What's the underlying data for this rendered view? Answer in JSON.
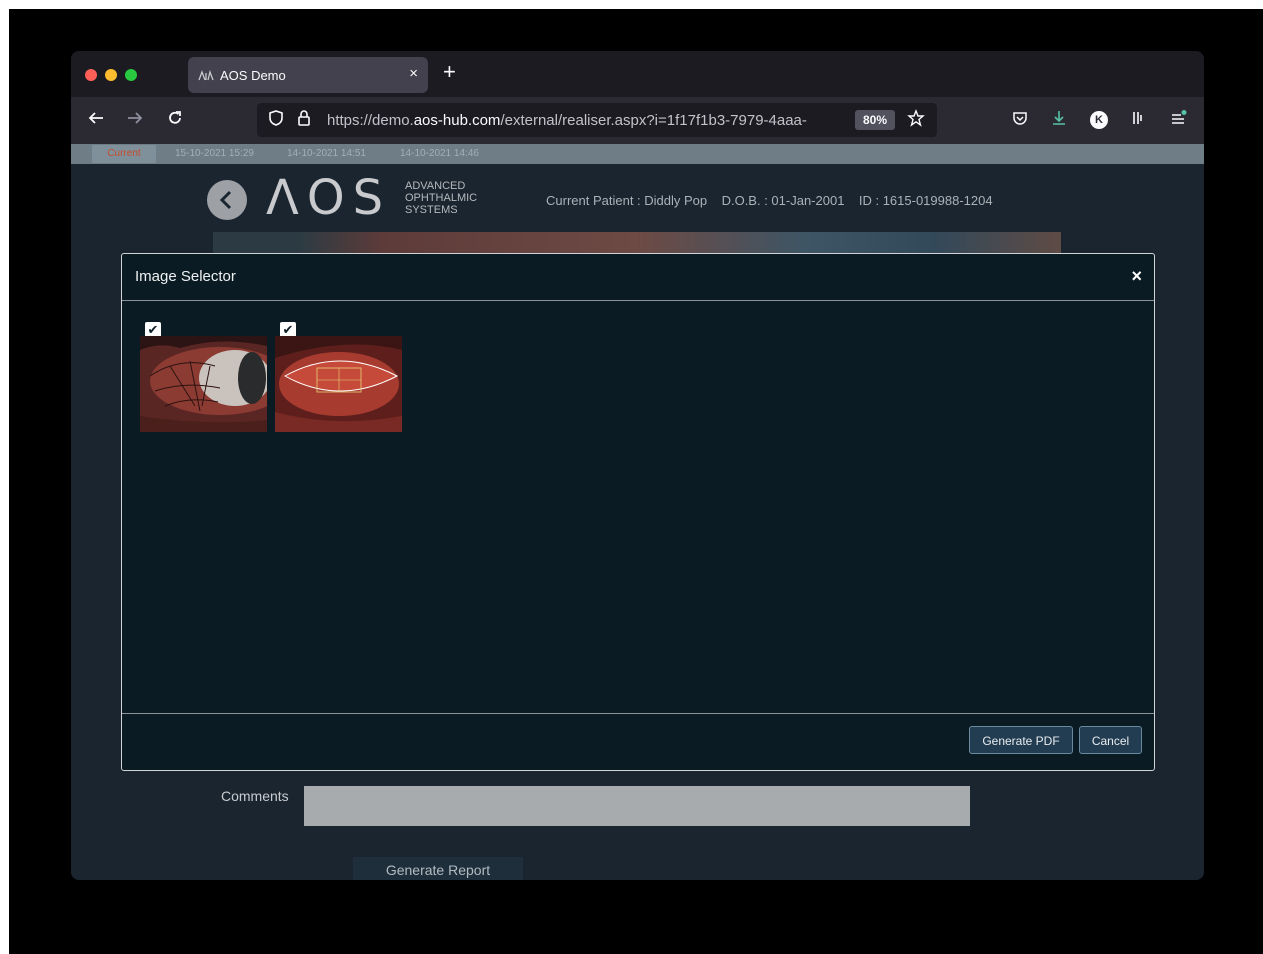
{
  "browser": {
    "tab_title": "AOS Demo",
    "tab_close": "×",
    "new_tab": "+",
    "url_prefix": "https://demo.",
    "url_domain": "aos-hub.com",
    "url_path": "/external/realiser.aspx?i=1f17f1b3-7979-4aaa-",
    "zoom": "80%",
    "profile_initial": "K"
  },
  "history": {
    "current": "Current",
    "items": [
      "15-10-2021 15:29",
      "14-10-2021 14:51",
      "14-10-2021 14:46"
    ]
  },
  "header": {
    "logo": "ΛOS",
    "logo_sub": [
      "ADVANCED",
      "OPHTHALMIC",
      "SYSTEMS"
    ],
    "patient": "Current Patient : Diddly Pop    D.O.B. : 01-Jan-2001    ID : 1615-019988-1204"
  },
  "modal": {
    "title": "Image Selector",
    "close": "×",
    "images": [
      {
        "checked": "✔",
        "icon": "eye-vessels-image"
      },
      {
        "checked": "✔",
        "icon": "eye-grid-image"
      }
    ],
    "generate_pdf": "Generate PDF",
    "cancel": "Cancel"
  },
  "page": {
    "comments_label": "Comments",
    "generate_report": "Generate Report"
  }
}
